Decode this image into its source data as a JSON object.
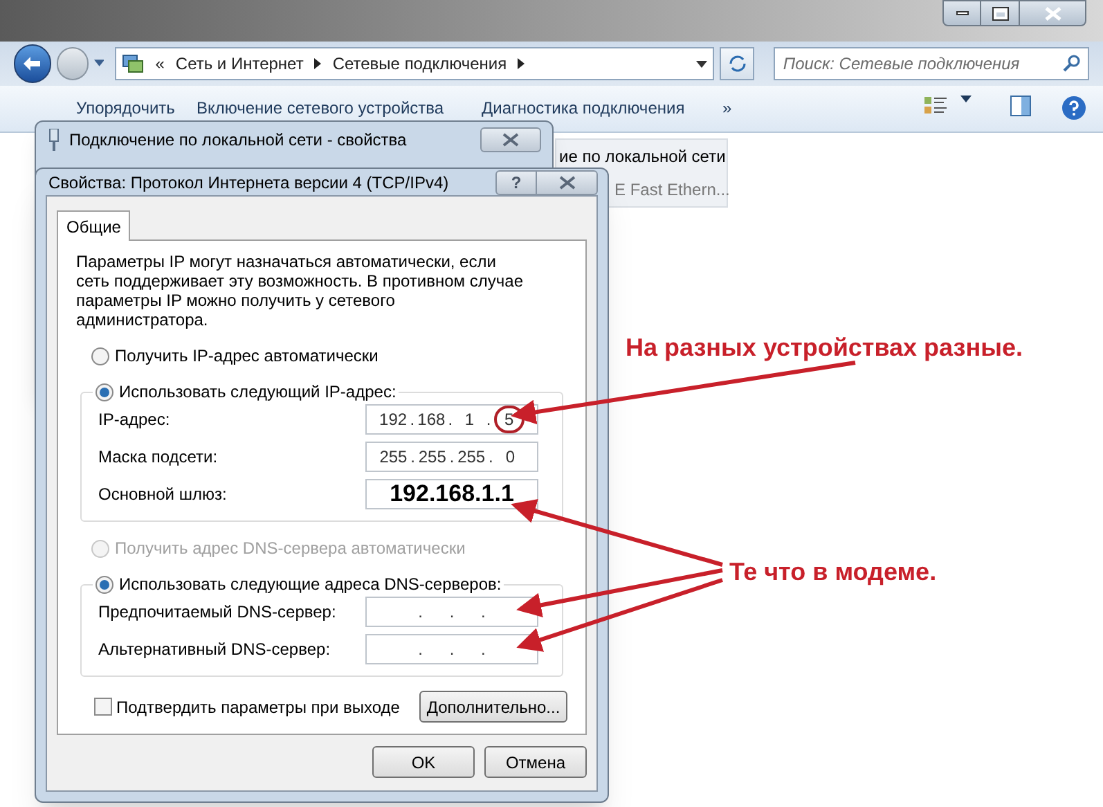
{
  "explorer": {
    "breadcrumb_prefix": "«",
    "breadcrumb": [
      "Сеть и Интернет",
      "Сетевые подключения"
    ],
    "search": {
      "placeholder": "Поиск: Сетевые подключения"
    },
    "toolbar": [
      "Упорядочить",
      "Включение сетевого устройства",
      "Диагностика подключения"
    ],
    "toolbar_more": "»",
    "item": {
      "line_1": "ие по локальной сети",
      "line_2": "E Fast Ethern..."
    }
  },
  "back_dialog": {
    "title": "Подключение по локальной сети - свойства"
  },
  "dialog": {
    "title": "Свойства: Протокол Интернета версии 4 (TCP/IPv4)",
    "help": "?",
    "tabs": [
      {
        "label": "Общие",
        "selected": true
      }
    ],
    "description": "Параметры IP могут назначаться автоматически, если сеть поддерживает эту возможность. В противном случае параметры IP можно получить у сетевого администратора.",
    "octet_separator": ".",
    "sections": [
      {
        "auto": {
          "label": "Получить IP-адрес автоматически",
          "selected": false,
          "disabled": false
        },
        "manual": {
          "label": "Использовать следующий IP-адрес:",
          "selected": true,
          "disabled": false
        },
        "fields": [
          {
            "label": "IP-адрес:",
            "kind": "octets",
            "octets": [
              "192",
              "168",
              "1",
              "5"
            ],
            "circled": true
          },
          {
            "label": "Маска подсети:",
            "kind": "octets",
            "octets": [
              "255",
              "255",
              "255",
              "0"
            ],
            "circled": false
          },
          {
            "label": "Основной шлюз:",
            "kind": "big",
            "value": "192.168.1.1",
            "circled": false
          }
        ]
      },
      {
        "auto": {
          "label": "Получить адрес DNS-сервера автоматически",
          "selected": false,
          "disabled": true
        },
        "manual": {
          "label": "Использовать следующие адреса DNS-серверов:",
          "selected": true,
          "disabled": false
        },
        "fields": [
          {
            "label": "Предпочитаемый DNS-сервер:",
            "kind": "blank",
            "circled": false
          },
          {
            "label": "Альтернативный DNS-сервер:",
            "kind": "blank",
            "circled": false
          }
        ]
      }
    ],
    "confirm": {
      "label": "Подтвердить параметры при выходе",
      "checked": false
    },
    "advanced": "Дополнительно...",
    "buttons": [
      "OK",
      "Отмена"
    ]
  },
  "annotations": [
    "На разных устройствах разные.",
    "Те что в модеме."
  ]
}
